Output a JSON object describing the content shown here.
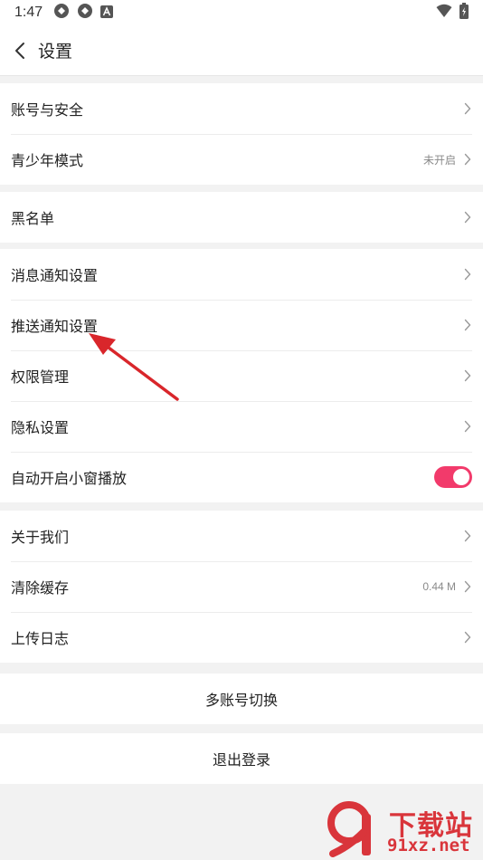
{
  "status_bar": {
    "time": "1:47"
  },
  "header": {
    "title": "设置"
  },
  "groups": {
    "account": [
      {
        "label": "账号与安全"
      },
      {
        "label": "青少年模式",
        "value": "未开启"
      }
    ],
    "blacklist": [
      {
        "label": "黑名单"
      }
    ],
    "notifications": [
      {
        "label": "消息通知设置"
      },
      {
        "label": "推送通知设置"
      },
      {
        "label": "权限管理"
      },
      {
        "label": "隐私设置"
      },
      {
        "label": "自动开启小窗播放",
        "toggle_on": true
      }
    ],
    "about": [
      {
        "label": "关于我们"
      },
      {
        "label": "清除缓存",
        "value": "0.44 M"
      },
      {
        "label": "上传日志"
      }
    ]
  },
  "actions": {
    "switch_account": "多账号切换",
    "logout": "退出登录"
  },
  "watermark": {
    "line1": "下载站",
    "line2": "91xz.net"
  },
  "colors": {
    "accent": "#f23a6b",
    "annotation_arrow": "#d9262b",
    "watermark": "#d9353b"
  }
}
